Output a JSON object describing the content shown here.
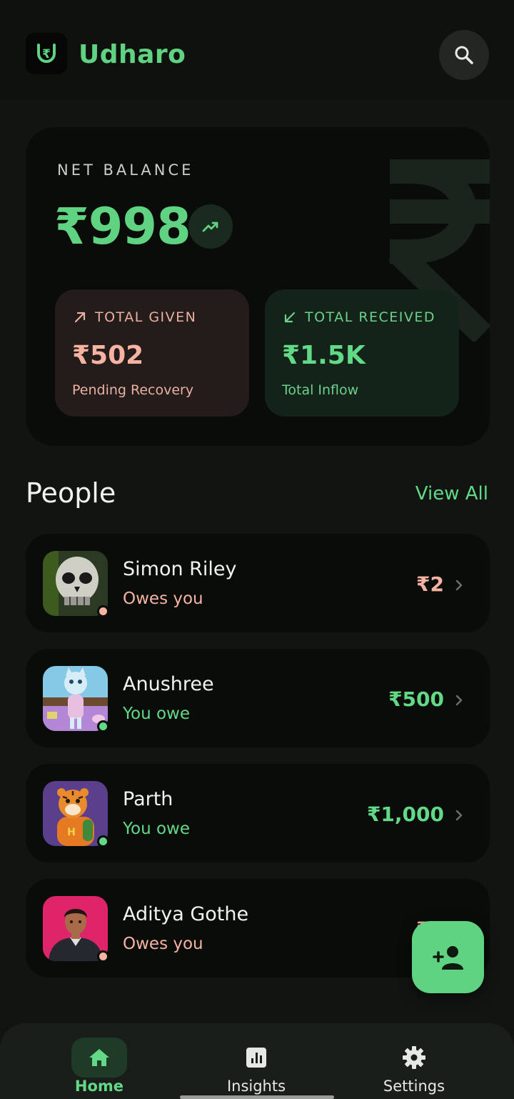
{
  "app": {
    "title": "Udharo",
    "logo_glyph": "₹"
  },
  "header": {
    "search_icon": "search-icon"
  },
  "balance": {
    "label": "NET BALANCE",
    "amount": "₹998",
    "trend_icon": "trending-up-icon",
    "given": {
      "label": "TOTAL GIVEN",
      "value": "₹502",
      "sub": "Pending Recovery",
      "icon": "arrow-up-right-icon"
    },
    "received": {
      "label": "TOTAL RECEIVED",
      "value": "₹1.5K",
      "sub": "Total Inflow",
      "icon": "arrow-down-left-icon"
    }
  },
  "people": {
    "title": "People",
    "view_all": "View All",
    "items": [
      {
        "name": "Simon Riley",
        "status": "Owes you",
        "amount": "₹2",
        "type": "owes-you"
      },
      {
        "name": "Anushree",
        "status": "You owe",
        "amount": "₹500",
        "type": "you-owe"
      },
      {
        "name": "Parth",
        "status": "You owe",
        "amount": "₹1,000",
        "type": "you-owe"
      },
      {
        "name": "Aditya Gothe",
        "status": "Owes you",
        "amount": "₹5",
        "type": "owes-you"
      }
    ]
  },
  "fab": {
    "icon": "add-person-icon"
  },
  "nav": {
    "items": [
      {
        "label": "Home",
        "icon": "home-icon",
        "active": true
      },
      {
        "label": "Insights",
        "icon": "bar-chart-icon",
        "active": false
      },
      {
        "label": "Settings",
        "icon": "gear-icon",
        "active": false
      }
    ]
  },
  "colors": {
    "accent": "#5fd381",
    "background": "#121412",
    "card": "#0a0c0a",
    "owes_you": "#f6b3a2",
    "you_owe": "#62d987"
  }
}
